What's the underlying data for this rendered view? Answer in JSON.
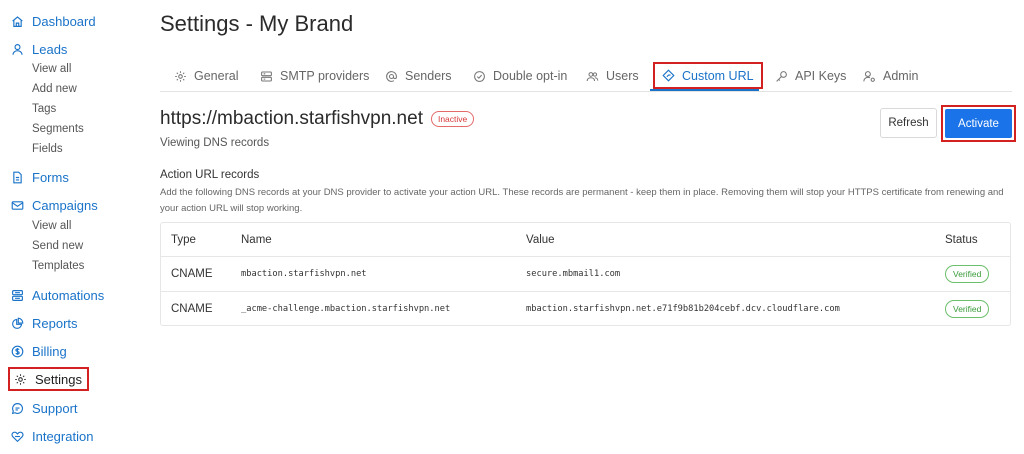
{
  "sidebar": {
    "items": [
      {
        "label": "Dashboard",
        "icon": "home-icon"
      },
      {
        "label": "Leads",
        "icon": "person-icon",
        "sub": [
          "View all",
          "Add new",
          "Tags",
          "Segments",
          "Fields"
        ]
      },
      {
        "label": "Forms",
        "icon": "document-icon"
      },
      {
        "label": "Campaigns",
        "icon": "envelope-icon",
        "sub": [
          "View all",
          "Send new",
          "Templates"
        ]
      },
      {
        "label": "Automations",
        "icon": "automation-icon"
      },
      {
        "label": "Reports",
        "icon": "pie-chart-icon"
      },
      {
        "label": "Billing",
        "icon": "dollar-icon"
      },
      {
        "label": "Settings",
        "icon": "gear-icon"
      },
      {
        "label": "Support",
        "icon": "chat-icon"
      },
      {
        "label": "Integration",
        "icon": "integration-icon"
      }
    ],
    "active": "Settings"
  },
  "page": {
    "title": "Settings - My Brand"
  },
  "tabs": [
    {
      "label": "General",
      "icon": "gear-icon"
    },
    {
      "label": "SMTP providers",
      "icon": "server-icon"
    },
    {
      "label": "Senders",
      "icon": "at-icon"
    },
    {
      "label": "Double opt-in",
      "icon": "check-circle-icon"
    },
    {
      "label": "Users",
      "icon": "users-icon"
    },
    {
      "label": "Custom URL",
      "icon": "diamond-icon"
    },
    {
      "label": "API Keys",
      "icon": "key-icon"
    },
    {
      "label": "Admin",
      "icon": "admin-icon"
    }
  ],
  "active_tab": "Custom URL",
  "domain": {
    "name": "https://mbaction.starfishvpn.net",
    "status": "Inactive",
    "subtitle": "Viewing DNS records"
  },
  "buttons": {
    "refresh": "Refresh",
    "activate": "Activate"
  },
  "section": {
    "title": "Action URL records",
    "description": "Add the following DNS records at your DNS provider to activate your action URL. These records are permanent - keep them in place. Removing them will stop your HTTPS certificate from renewing and your action URL will stop working."
  },
  "table": {
    "headers": [
      "Type",
      "Name",
      "Value",
      "Status"
    ],
    "rows": [
      {
        "type": "CNAME",
        "name": "mbaction.starfishvpn.net",
        "value": "secure.mbmail1.com",
        "status": "Verified"
      },
      {
        "type": "CNAME",
        "name": "_acme-challenge.mbaction.starfishvpn.net",
        "value": "mbaction.starfishvpn.net.e71f9b81b204cebf.dcv.cloudflare.com",
        "status": "Verified"
      }
    ]
  },
  "colors": {
    "accent": "#1a73c9",
    "primary_button": "#1a73e8",
    "highlight": "#d32020",
    "inactive": "#d63a3a",
    "verified": "#3a9b3a"
  }
}
